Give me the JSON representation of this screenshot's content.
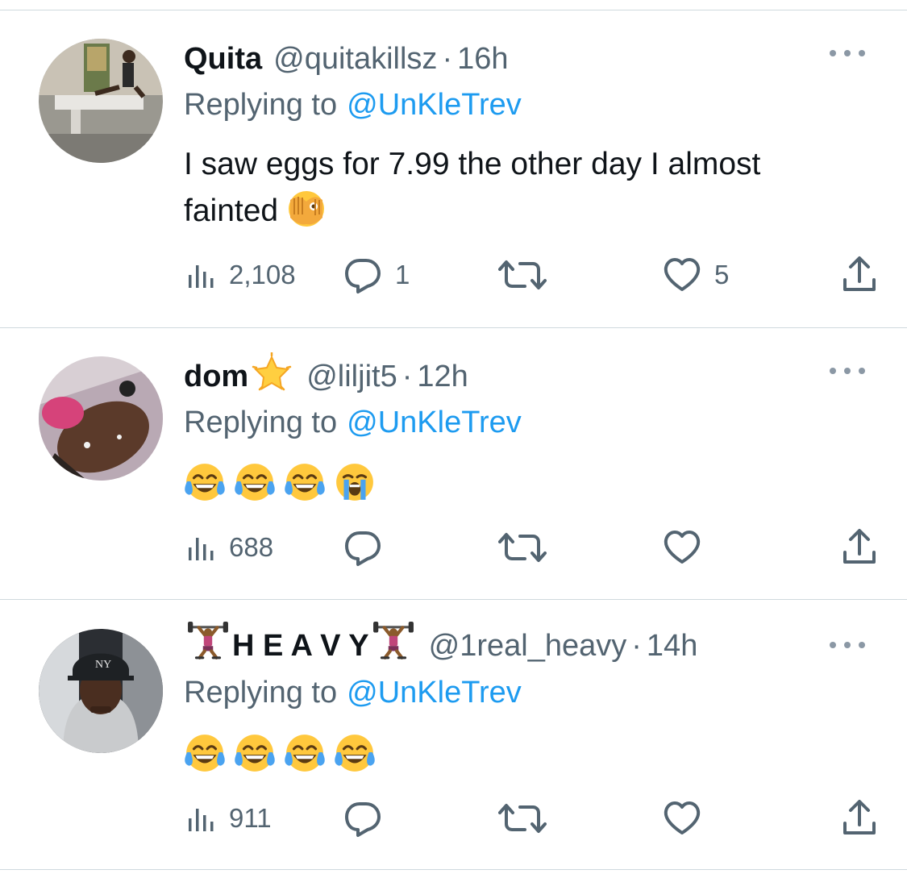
{
  "tweets": [
    {
      "display_name": "Quita",
      "handle": "@quitakillsz",
      "separator": "·",
      "time": "16h",
      "replying_prefix": "Replying to",
      "replying_to": "@UnKleTrev",
      "text_line1": "I saw eggs for 7.99 the other day I almost",
      "text_line2": "fainted",
      "text_emoji": "face-with-open-eyes-and-hand-over-mouth",
      "views": "2,108",
      "replies": "1",
      "retweets": "",
      "likes": "5"
    },
    {
      "display_name": "dom",
      "name_emoji": "glowing-star",
      "handle": "@liljit5",
      "separator": "·",
      "time": "12h",
      "replying_prefix": "Replying to",
      "replying_to": "@UnKleTrev",
      "emojis": [
        "face-with-tears-of-joy",
        "face-with-tears-of-joy",
        "face-with-tears-of-joy",
        "loudly-crying-face"
      ],
      "views": "688",
      "replies": "",
      "retweets": "",
      "likes": ""
    },
    {
      "display_name": "H E A V Y",
      "name_emoji": "weightlifter",
      "handle": "@1real_heavy",
      "separator": "·",
      "time": "14h",
      "replying_prefix": "Replying to",
      "replying_to": "@UnKleTrev",
      "emojis": [
        "face-with-tears-of-joy",
        "face-with-tears-of-joy",
        "face-with-tears-of-joy",
        "face-with-tears-of-joy"
      ],
      "views": "911",
      "replies": "",
      "retweets": "",
      "likes": ""
    }
  ],
  "icons": {
    "views": "bar-chart-icon",
    "reply": "speech-bubble-icon",
    "retweet": "retweet-icon",
    "like": "heart-icon",
    "share": "share-icon",
    "more": "more-dots-icon"
  },
  "colors": {
    "text": "#0f1419",
    "secondary": "#536471",
    "link": "#1d9bf0",
    "divider": "#cfd9de"
  }
}
